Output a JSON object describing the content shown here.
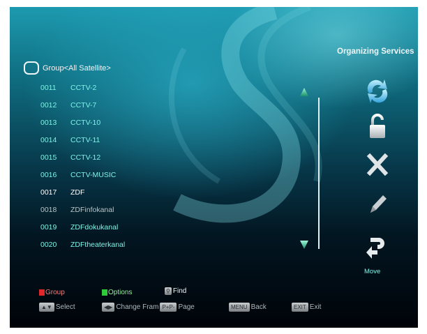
{
  "panel": {
    "title": "Organizing Services",
    "move_label": "Move"
  },
  "group": {
    "label": "Group<All Satellite>"
  },
  "channels": [
    {
      "num": "0011",
      "name": "CCTV-2"
    },
    {
      "num": "0012",
      "name": "CCTV-7"
    },
    {
      "num": "0013",
      "name": "CCTV-10"
    },
    {
      "num": "0014",
      "name": "CCTV-11"
    },
    {
      "num": "0015",
      "name": "CCTV-12"
    },
    {
      "num": "0016",
      "name": "CCTV-MUSIC"
    },
    {
      "num": "0017",
      "name": "ZDF"
    },
    {
      "num": "0018",
      "name": "ZDFinfokanal"
    },
    {
      "num": "0019",
      "name": "ZDFdokukanal"
    },
    {
      "num": "0020",
      "name": "ZDFtheaterkanal"
    }
  ],
  "actions": [
    "refresh-icon",
    "lock-icon",
    "delete-icon",
    "rename-pencil-icon",
    "move-icon"
  ],
  "help": {
    "group": "Group",
    "options": "Options",
    "find": "Find",
    "select": "Select",
    "change_frame": "Change Fram",
    "page_key": "P+P-",
    "page": "Page",
    "menu_key": "MENU",
    "back": "Back",
    "exit_key": "EXIT",
    "exit": "Exit"
  },
  "colors": {
    "channel_text": "#7ff2e6",
    "selected_text": "#ffffff",
    "red_key": "#e0282c",
    "green_key": "#2fcb3a"
  }
}
